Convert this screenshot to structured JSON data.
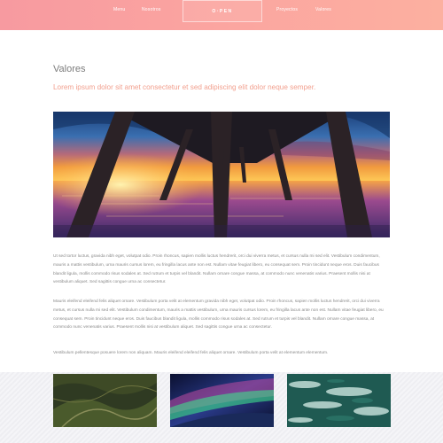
{
  "header": {
    "nav": [
      "Menu",
      "Nosotros",
      "Proyectos",
      "Valores"
    ],
    "logo": "O·PEN"
  },
  "main": {
    "title": "Valores",
    "subtitle": "Lorem ipsum dolor sit amet consectetur et sed adipiscing elit dolor neque semper.",
    "paragraphs": [
      "Ut sed tortor luctus, gravida nibh eget, volutpat odio. Proin rhoncus, sapien mollis luctus hendrerit, orci dui viverra metus, et cursus nulla mi sed elit. Vestibulum condimentum, mauris a mattis vestibulum, urna mauris cursus lorem, eu fringilla lacus ante non est. Nullam vitae feugiat libero, eu consequat sem. Proin tincidunt neque eros. Duis faucibus blandit ligula, mollis commodo risus sodales at. Sed rutrum et turpis vel blandit. Nullam ornare congue massa, at commodo nunc venenatis varius. Praesent mollis nisi at vestibulum aliquet. Sed sagittis congue urna ac consectetur.",
      "Mauris eleifend eleifend felis aliquet ornare. Vestibulum porta velit at elementum gravida nibh eget, volutpat odio. Proin rhoncus, sapien mollis luctus hendrerit, orci dui viverra metus, et cursus nulla mi sed elit. Vestibulum condimentum, mauris a mattis vestibulum, urna mauris cursus lorem, eu fringilla lacus ante non est. Nullam vitae feugiat libero, eu consequat sem. Proin tincidunt neque eros. Duis faucibus blandit ligula, mollis commodo risus sodales at. Sed rutrum et turpis vel blandit. Nullam ornare congue massa, at commodo nunc venenatis varius. Praesent mollis nisi at vestibulum aliquet. Sed sagittis congue urna ac consectetur.",
      "Vestibulum pellentesque posuere lorem non aliquam. Mauris eleifend eleifend felis aliquet ornare. Vestibulum porta velit at elementum elementum."
    ]
  },
  "colors": {
    "header_gradient_start": "#f79aa0",
    "header_gradient_end": "#fcb0a0",
    "accent_subtitle": "#f2a08f",
    "body_text": "#8a8a8a"
  }
}
